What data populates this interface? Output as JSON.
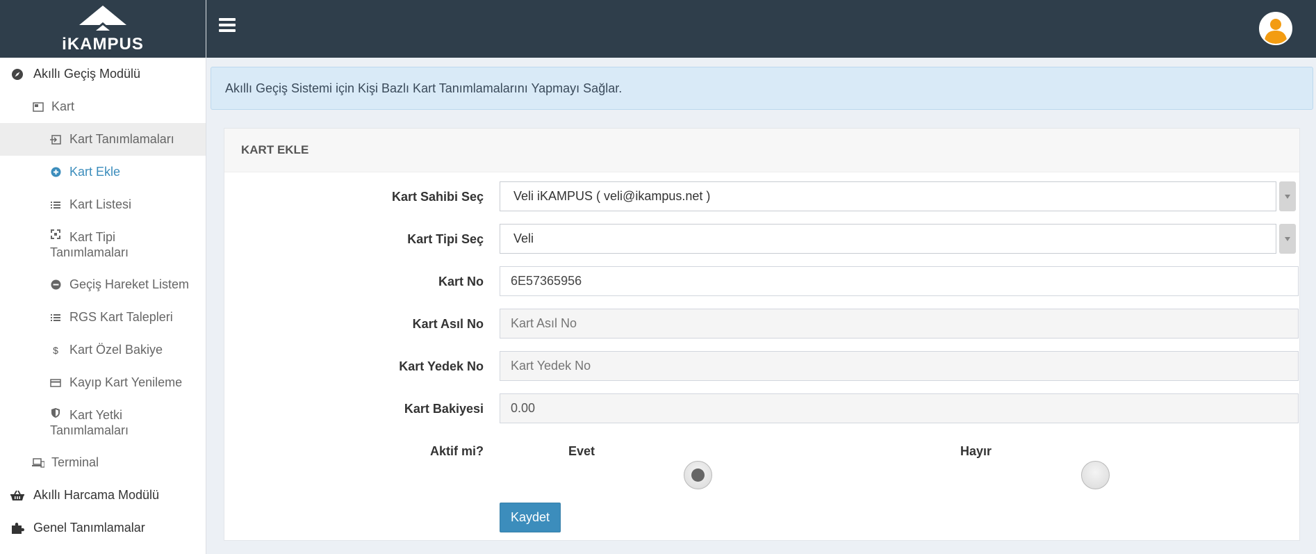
{
  "brand": {
    "name": "iKAMPUS"
  },
  "sidebar": {
    "module_main": "Akıllı Geçiş Modülü",
    "kart": "Kart",
    "items": [
      {
        "label": "Kart Tanımlamaları"
      },
      {
        "label": "Kart Ekle"
      },
      {
        "label": "Kart Listesi"
      },
      {
        "label_line1": "Kart Tipi",
        "label_line2": "Tanımlamaları"
      },
      {
        "label": "Geçiş Hareket Listem"
      },
      {
        "label": "RGS Kart Talepleri"
      },
      {
        "label": "Kart Özel Bakiye"
      },
      {
        "label": "Kayıp Kart Yenileme"
      },
      {
        "label_line1": "Kart Yetki",
        "label_line2": "Tanımlamaları"
      }
    ],
    "terminal": "Terminal",
    "module_spending": "Akıllı Harcama Modülü",
    "module_general": "Genel Tanımlamalar"
  },
  "callout": {
    "text": "Akıllı Geçiş Sistemi için Kişi Bazlı Kart Tanımlamalarını Yapmayı Sağlar."
  },
  "form": {
    "title": "KART EKLE",
    "owner_label": "Kart Sahibi Seç",
    "owner_value": "Veli iKAMPUS ( veli@ikampus.net )",
    "type_label": "Kart Tipi Seç",
    "type_value": "Veli",
    "card_no_label": "Kart No",
    "card_no_value": "6E57365956",
    "card_main_label": "Kart Asıl No",
    "card_main_placeholder": "Kart Asıl No",
    "card_backup_label": "Kart Yedek No",
    "card_backup_placeholder": "Kart Yedek No",
    "balance_label": "Kart Bakiyesi",
    "balance_value": "0.00",
    "active_label": "Aktif mi?",
    "yes_label": "Evet",
    "no_label": "Hayır",
    "active_selected": "Evet",
    "save_label": "Kaydet"
  },
  "colors": {
    "topbar": "#2f3e4b",
    "accent": "#3c8dbc",
    "callout_bg": "#d9eaf7",
    "avatar": "#f39c12"
  }
}
